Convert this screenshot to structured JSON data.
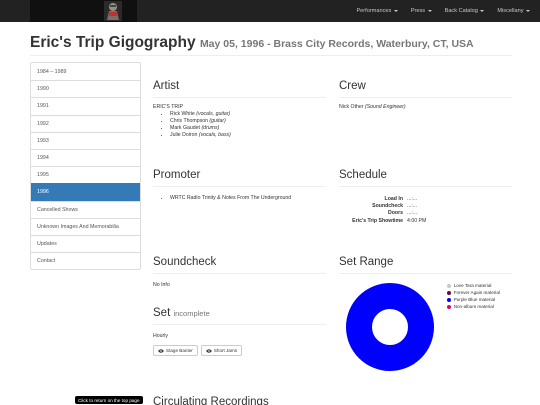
{
  "navbar": {
    "items": [
      {
        "label": "Performances"
      },
      {
        "label": "Press"
      },
      {
        "label": "Back Catalog"
      },
      {
        "label": "Miscellany"
      }
    ]
  },
  "page": {
    "title": "Eric's Trip Gigography",
    "subtitle": "May 05, 1996 - Brass City Records, Waterbury, CT, USA"
  },
  "sidebar": {
    "items": [
      {
        "label": "1984 – 1989"
      },
      {
        "label": "1990"
      },
      {
        "label": "1991"
      },
      {
        "label": "1992"
      },
      {
        "label": "1993"
      },
      {
        "label": "1994"
      },
      {
        "label": "1995"
      },
      {
        "label": "1996"
      },
      {
        "label": "Cancelled Shows"
      },
      {
        "label": "Unknown Images And Memorabilia"
      },
      {
        "label": "Updates"
      },
      {
        "label": "Contact"
      }
    ],
    "active_index": 7
  },
  "artist": {
    "heading": "Artist",
    "name": "ERIC'S TRIP",
    "members": [
      {
        "name": "Rick White",
        "role": "(vocals, guitar)"
      },
      {
        "name": "Chris Thompson",
        "role": "(guitar)"
      },
      {
        "name": "Mark Gaudet",
        "role": "(drums)"
      },
      {
        "name": "Julie Doiron",
        "role": "(vocals, bass)"
      }
    ]
  },
  "crew": {
    "heading": "Crew",
    "name": "Nick Other",
    "role": "(Sound Engineer)"
  },
  "promoter": {
    "heading": "Promoter",
    "items": [
      "WRTC Radio Trinity & Notes From The Underground"
    ]
  },
  "schedule": {
    "heading": "Schedule",
    "rows": [
      {
        "label": "Load In",
        "value": "...:..."
      },
      {
        "label": "Soundcheck",
        "value": "...:..."
      },
      {
        "label": "Doors",
        "value": "...:..."
      },
      {
        "label": "Eric's Trip Showtime",
        "value": "4:00 PM"
      }
    ]
  },
  "soundcheck": {
    "heading": "Soundcheck",
    "text": "No Info"
  },
  "set": {
    "heading": "Set",
    "status": "incomplete",
    "text": "Hourly",
    "buttons": [
      {
        "label": "Stage Banter"
      },
      {
        "label": "Short Jams"
      }
    ]
  },
  "set_range": {
    "heading": "Set Range",
    "legend": [
      {
        "label": "Love Tara material",
        "color": "#c8c8c8"
      },
      {
        "label": "Forever Again material",
        "color": "#6a0a3a"
      },
      {
        "label": "Purple Blue material",
        "color": "#0000ff"
      },
      {
        "label": "Non-album material",
        "color": "#e0006e"
      }
    ]
  },
  "chart_data": {
    "type": "pie",
    "categories": [
      "Love Tara material",
      "Forever Again material",
      "Purple Blue material",
      "Non-album material"
    ],
    "values": [
      0,
      0,
      1,
      0
    ],
    "colors": [
      "#c8c8c8",
      "#6a0a3a",
      "#0000ff",
      "#e0006e"
    ]
  },
  "footer": {
    "next_heading": "Circulating Recordings",
    "tooltip": "Click to return on the top page"
  }
}
